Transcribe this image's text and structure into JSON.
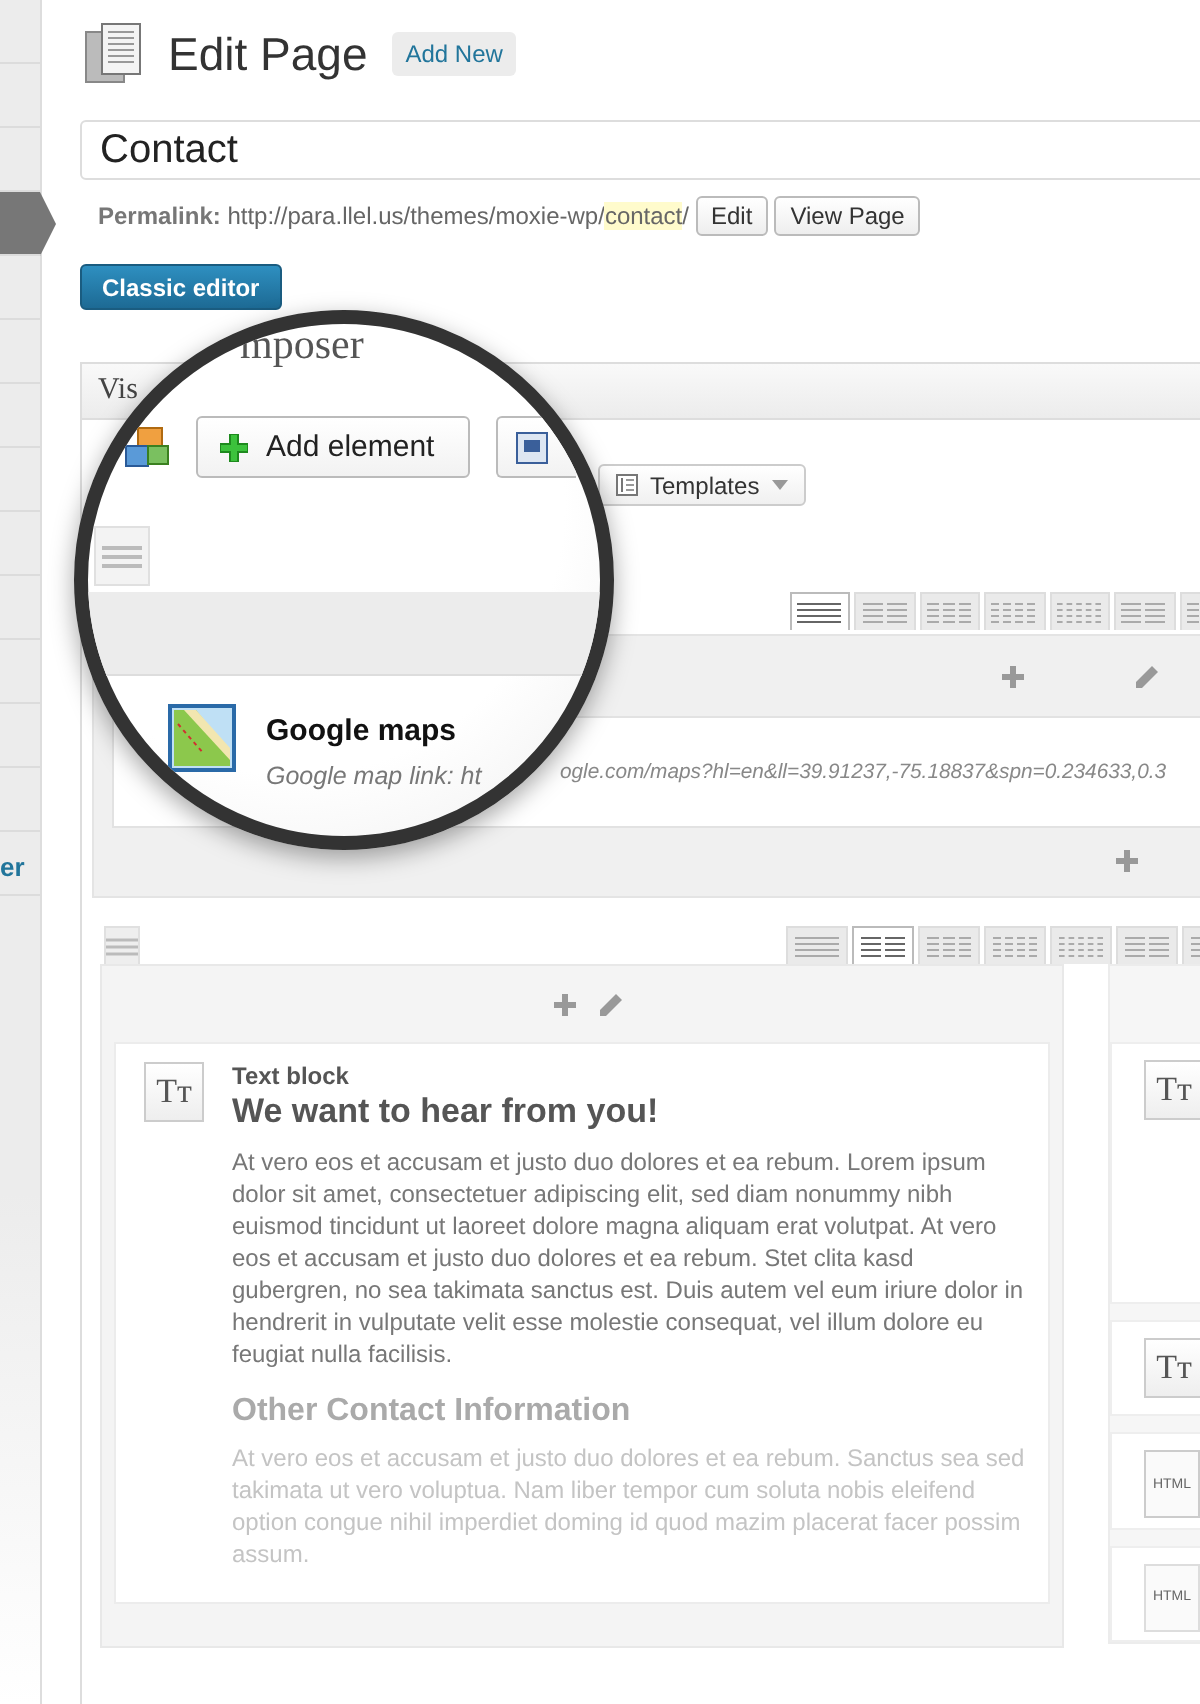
{
  "sidebar": {
    "items": [
      {
        "selected": false
      },
      {
        "selected": false
      },
      {
        "selected": false
      },
      {
        "selected": true
      },
      {
        "selected": false
      },
      {
        "selected": false
      },
      {
        "selected": false
      },
      {
        "selected": false
      },
      {
        "selected": false
      },
      {
        "selected": false
      },
      {
        "selected": false
      },
      {
        "selected": false
      },
      {
        "selected": false
      },
      {
        "label": "er",
        "selected": false
      }
    ]
  },
  "header": {
    "title": "Edit Page",
    "add_new": "Add New"
  },
  "title_field": {
    "value": "Contact"
  },
  "permalink": {
    "label": "Permalink:",
    "url": "http://para.llel.us/themes/moxie-wp/",
    "slug": "contact",
    "suffix": "/",
    "buttons": [
      "Edit",
      "View Page"
    ]
  },
  "classic_editor": "Classic editor",
  "composer": {
    "title": "Vis",
    "magnified_title": "mposer",
    "add_element": "Add element",
    "templates": "Templates",
    "rows": [
      {
        "layouts": [
          {
            "selected": true
          },
          {
            "selected": false
          },
          {
            "selected": false
          },
          {
            "selected": false
          },
          {
            "selected": false
          },
          {
            "selected": false
          },
          {
            "selected": false
          }
        ],
        "element": {
          "title": "Google maps",
          "link_label": "Google map link: ht",
          "link_tail": "ogle.com/maps?hl=en&ll=39.91237,-75.18837&spn=0.234633,0.3"
        }
      },
      {
        "layouts": [
          {
            "selected": false
          },
          {
            "selected": true
          },
          {
            "selected": false
          },
          {
            "selected": false
          },
          {
            "selected": false
          },
          {
            "selected": false
          },
          {
            "selected": false
          }
        ],
        "text_block": {
          "icon_text": "Tт",
          "label": "Text block",
          "heading": "We want to hear from you!",
          "paragraph": "At vero eos et accusam et justo duo dolores et ea rebum. Lorem ipsum dolor sit amet, consectetuer adipiscing elit, sed diam nonummy nibh euismod tincidunt ut laoreet dolore magna aliquam erat volutpat. At vero eos et accusam et justo duo dolores et ea rebum. Stet clita kasd gubergren, no sea takimata sanctus est. Duis autem vel eum iriure dolor in hendrerit in vulputate velit esse molestie consequat, vel illum dolore eu feugiat nulla facilisis.",
          "heading_2": "Other Contact Information",
          "paragraph_2": "At vero eos et accusam et justo duo dolores et ea rebum. Sanctus sea sed takimata ut vero voluptua. Nam liber tempor cum soluta nobis eleifend option congue nihil imperdiet doming id quod mazim placerat facer possim assum."
        },
        "side_elements": [
          {
            "kind": "text",
            "icon_text": "Tт"
          },
          {
            "kind": "text",
            "icon_text": "Tт"
          },
          {
            "kind": "html",
            "icon_text": "HTML"
          },
          {
            "kind": "html",
            "icon_text": "HTML"
          }
        ]
      }
    ]
  }
}
